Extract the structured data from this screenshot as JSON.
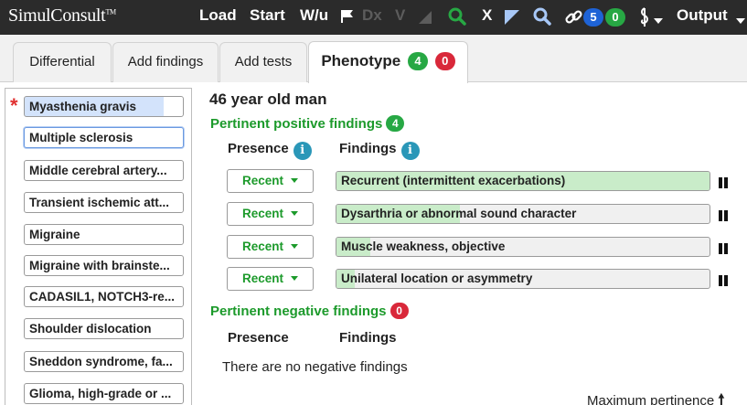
{
  "app": {
    "logo": "SimulConsult",
    "logo_tm": "TM"
  },
  "toolbar": {
    "load": "Load",
    "start": "Start",
    "wu": "W/u",
    "dx": "Dx",
    "v": "V",
    "x": "X",
    "link_count": "5",
    "link_count2": "0",
    "output": "Output",
    "colors": {
      "bg": "#2b2b2b",
      "green": "#27a844",
      "blue": "#1e63d6"
    }
  },
  "tabs": [
    {
      "label": "Differential"
    },
    {
      "label": "Add findings"
    },
    {
      "label": "Add tests"
    },
    {
      "label": "Phenotype",
      "badge_green": "4",
      "badge_red": "0",
      "active": true
    }
  ],
  "differential": [
    {
      "label": "Myasthenia gravis",
      "flagged": true
    },
    {
      "label": "Multiple sclerosis",
      "selected": true
    },
    {
      "label": "Middle cerebral artery..."
    },
    {
      "label": "Transient ischemic att..."
    },
    {
      "label": "Migraine"
    },
    {
      "label": "Migraine with brainste..."
    },
    {
      "label": "CADASIL1, NOTCH3-re..."
    },
    {
      "label": "Shoulder dislocation"
    },
    {
      "label": "Sneddon syndrome, fa..."
    },
    {
      "label": "Glioma, high-grade or ..."
    }
  ],
  "case": {
    "title": "46 year old man",
    "positive_heading": "Pertinent positive findings",
    "positive_count": "4",
    "negative_heading": "Pertinent negative findings",
    "negative_count": "0",
    "presence_header": "Presence",
    "findings_header": "Findings",
    "info_glyph": "i",
    "positive_findings": [
      {
        "presence": "Recent",
        "finding": "Recurrent (intermittent exacerbations)",
        "pertinence": 1.0
      },
      {
        "presence": "Recent",
        "finding": "Dysarthria or abnormal sound character",
        "pertinence": 0.33
      },
      {
        "presence": "Recent",
        "finding": "Muscle weakness, objective",
        "pertinence": 0.09
      },
      {
        "presence": "Recent",
        "finding": "Unilateral location or asymmetry",
        "pertinence": 0.05
      }
    ],
    "no_negatives": "There are no negative findings",
    "max_pertinence": "Maximum pertinence"
  }
}
